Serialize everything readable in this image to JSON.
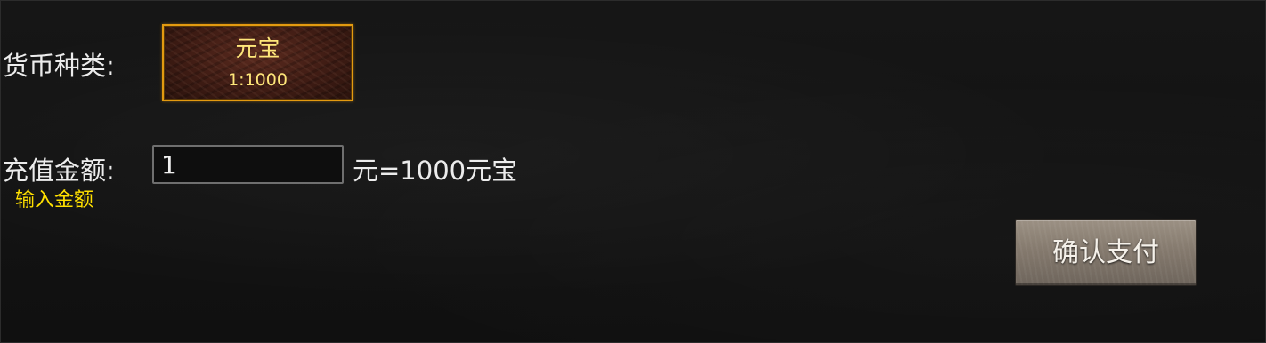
{
  "currency": {
    "label": "货币种类:",
    "option": {
      "name": "元宝",
      "rate": "1:1000"
    }
  },
  "amount": {
    "label": "充值金额:",
    "value": "1",
    "rate_text": "元=1000元宝",
    "hint": "输入金额"
  },
  "confirm_label": "确认支付",
  "colors": {
    "highlight_text": "#ffe000",
    "option_border": "#e39a10",
    "background": "#131313"
  }
}
